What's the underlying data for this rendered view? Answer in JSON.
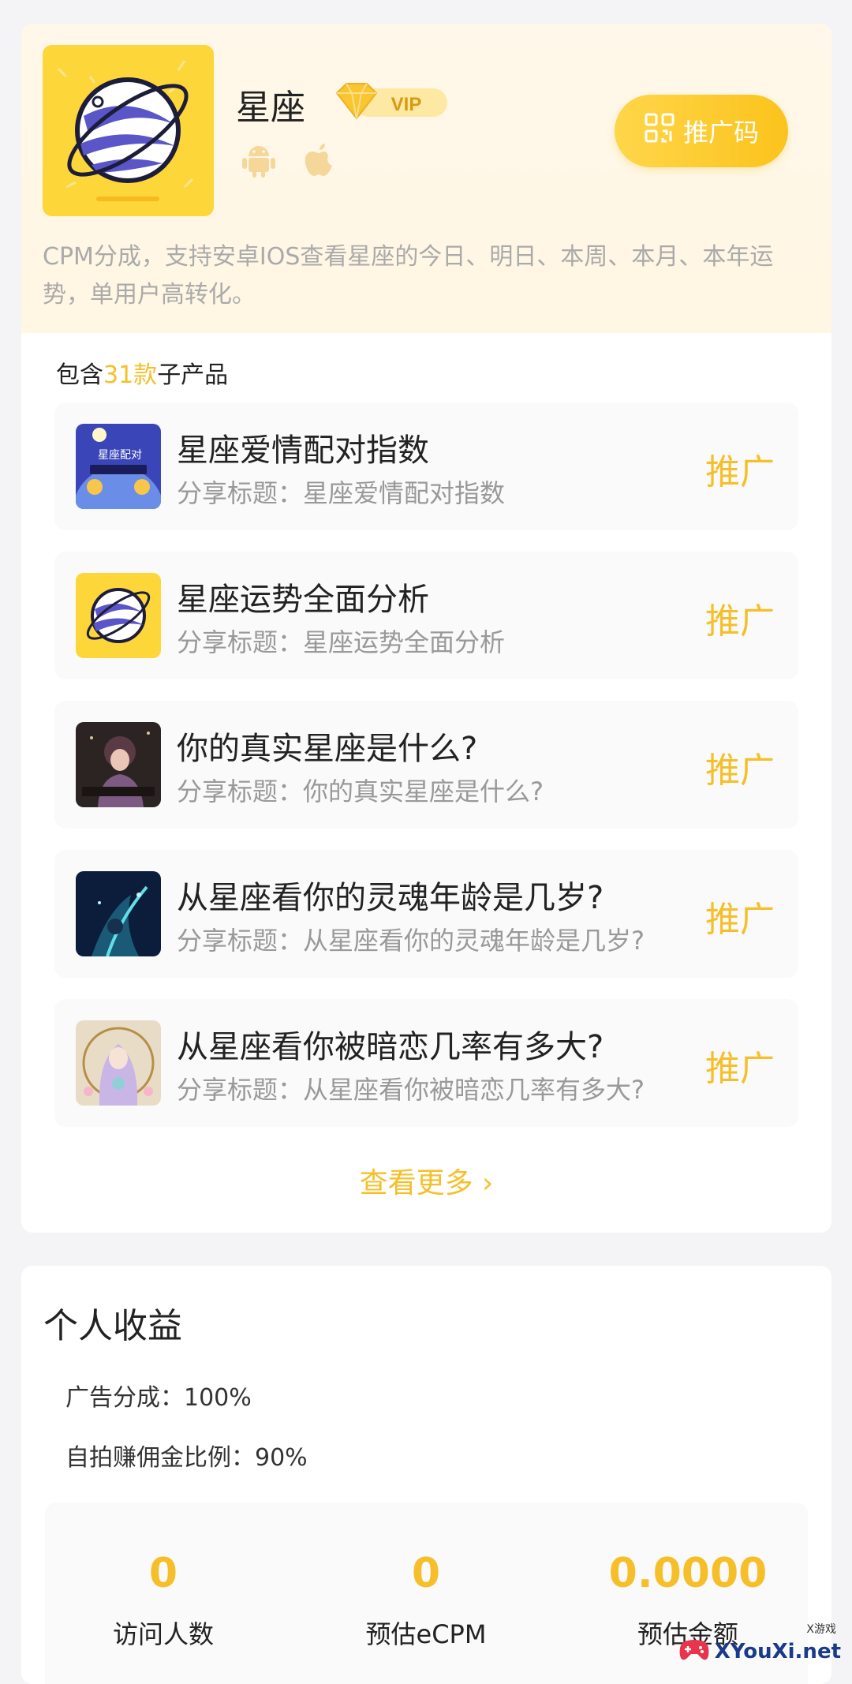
{
  "app": {
    "name": "星座",
    "vip_label": "VIP",
    "promo_code_label": "推广码",
    "description": "CPM分成，支持安卓IOS查看星座的今日、明日、本周、本月、本年运势，单用户高转化。",
    "platform_icons": [
      "android-icon",
      "apple-icon"
    ]
  },
  "subproducts": {
    "prefix": "包含",
    "count": "31款",
    "suffix": "子产品",
    "items": [
      {
        "title": "星座爱情配对指数",
        "share": "分享标题：星座爱情配对指数",
        "action": "推广",
        "thumb_text": "星座配对"
      },
      {
        "title": "星座运势全面分析",
        "share": "分享标题：星座运势全面分析",
        "action": "推广"
      },
      {
        "title": "你的真实星座是什么?",
        "share": "分享标题：你的真实星座是什么?",
        "action": "推广"
      },
      {
        "title": "从星座看你的灵魂年龄是几岁?",
        "share": "分享标题：从星座看你的灵魂年龄是几岁?",
        "action": "推广"
      },
      {
        "title": "从星座看你被暗恋几率有多大?",
        "share": "分享标题：从星座看你被暗恋几率有多大?",
        "action": "推广"
      }
    ],
    "more_label": "查看更多 ›"
  },
  "earnings": {
    "title": "个人收益",
    "ad_share": "广告分成：100%",
    "commission": "自拍赚佣金比例：90%",
    "stats": [
      {
        "value": "0",
        "label": "访问人数"
      },
      {
        "value": "0",
        "label": "预估eCPM"
      },
      {
        "value": "0.0000",
        "label": "预估金额"
      }
    ]
  },
  "watermark": {
    "text": "XYouXi.net",
    "small": "X游戏"
  },
  "colors": {
    "accent": "#f6bf2a",
    "icon_bg": "#fdd63a",
    "planet_purple": "#5a56c8"
  }
}
